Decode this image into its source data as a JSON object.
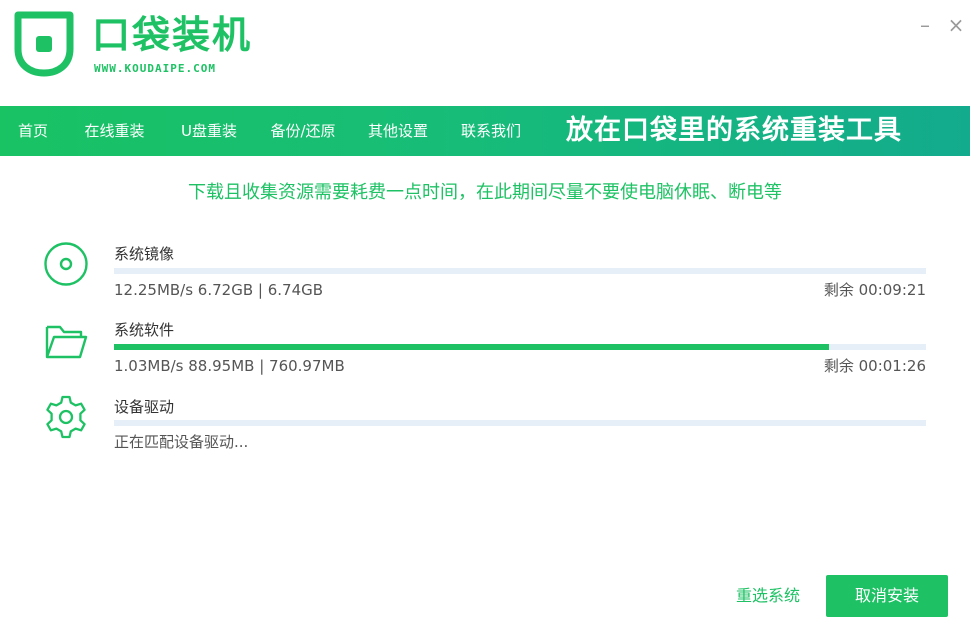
{
  "header": {
    "brand_name": "口袋装机",
    "brand_url": "WWW.KOUDAIPE.COM",
    "minimize_label": "–",
    "close_label": "×"
  },
  "nav": {
    "items": [
      {
        "label": "首页",
        "active": false
      },
      {
        "label": "在线重装",
        "active": true
      },
      {
        "label": "U盘重装",
        "active": false
      },
      {
        "label": "备份/还原",
        "active": false
      },
      {
        "label": "其他设置",
        "active": false
      },
      {
        "label": "联系我们",
        "active": false
      }
    ],
    "slogan": "放在口袋里的系统重装工具"
  },
  "notice": "下载且收集资源需要耗费一点时间，在此期间尽量不要使电脑休眠、断电等",
  "tasks": [
    {
      "title": "系统镜像",
      "icon": "disc-icon",
      "stats": "12.25MB/s 6.72GB | 6.74GB",
      "remaining": "剩余 00:09:21",
      "progress": 0
    },
    {
      "title": "系统软件",
      "icon": "folder-icon",
      "stats": "1.03MB/s 88.95MB | 760.97MB",
      "remaining": "剩余 00:01:26",
      "progress": 0.88
    },
    {
      "title": "设备驱动",
      "icon": "gear-icon",
      "stats": "正在匹配设备驱动...",
      "remaining": "",
      "progress": 0
    }
  ],
  "buttons": {
    "reselect": "重选系统",
    "cancel": "取消安装"
  },
  "colors": {
    "accent": "#1ec264",
    "nav_start": "#19c263",
    "nav_end": "#13ab8d",
    "track": "#e6eef8"
  }
}
